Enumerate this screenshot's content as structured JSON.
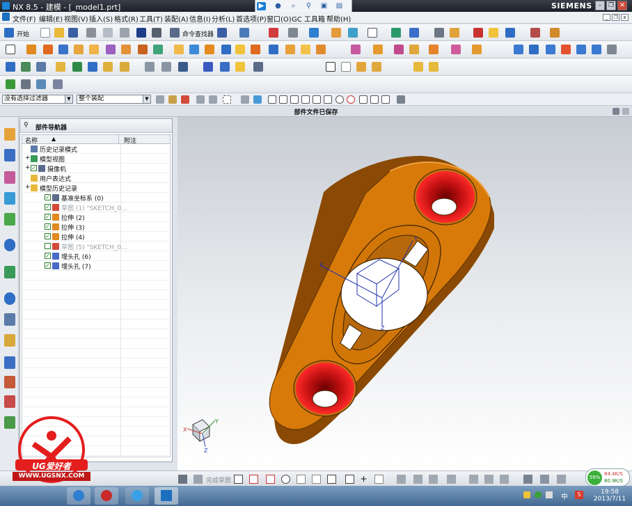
{
  "window": {
    "title": "NX 8.5 - 建模 - [_model1.prt]",
    "brand": "SIEMENS"
  },
  "menu": [
    "文件(F)",
    "编辑(E)",
    "视图(V)",
    "插入(S)",
    "格式(R)",
    "工具(T)",
    "装配(A)",
    "信息(I)",
    "分析(L)",
    "首选项(P)",
    "窗口(O)",
    "GC 工具箱",
    "帮助(H)"
  ],
  "toolbar": {
    "start_label": "开始",
    "command_finder_label": "命令查找器"
  },
  "selection": {
    "filter_value": "没有选择过滤器",
    "scope_value": "整个装配"
  },
  "status": {
    "message": "部件文件已保存"
  },
  "navigator": {
    "title": "部件导航器",
    "columns": [
      "名称",
      "附注"
    ],
    "items": [
      {
        "label": "历史记录模式",
        "level": 0,
        "icon": "clock-icon",
        "checked": null,
        "dim": false,
        "expander": false
      },
      {
        "label": "模型视图",
        "level": 0,
        "icon": "model-views-icon",
        "checked": null,
        "dim": false,
        "expander": true
      },
      {
        "label": "摄像机",
        "level": 0,
        "icon": "camera-icon",
        "checked": true,
        "dim": false,
        "expander": true
      },
      {
        "label": "用户表达式",
        "level": 0,
        "icon": "folder-icon",
        "checked": null,
        "dim": false,
        "expander": false
      },
      {
        "label": "模型历史记录",
        "level": 0,
        "icon": "folder-open-icon",
        "checked": null,
        "dim": false,
        "expander": true
      },
      {
        "label": "基准坐标系 (0)",
        "level": 1,
        "icon": "datum-csys-icon",
        "checked": true,
        "dim": false,
        "expander": false
      },
      {
        "label": "草图 (1) \"SKETCH_0...",
        "level": 1,
        "icon": "sketch-icon",
        "checked": true,
        "dim": true,
        "expander": false
      },
      {
        "label": "拉伸 (2)",
        "level": 1,
        "icon": "extrude-icon",
        "checked": true,
        "dim": false,
        "expander": false
      },
      {
        "label": "拉伸 (3)",
        "level": 1,
        "icon": "extrude-icon",
        "checked": true,
        "dim": false,
        "expander": false
      },
      {
        "label": "拉伸 (4)",
        "level": 1,
        "icon": "extrude-icon",
        "checked": true,
        "dim": false,
        "expander": false
      },
      {
        "label": "草图 (5) \"SKETCH_0...",
        "level": 1,
        "icon": "sketch-icon",
        "checked": false,
        "dim": true,
        "expander": false
      },
      {
        "label": "埋头孔 (6)",
        "level": 1,
        "icon": "countersink-hole-icon",
        "checked": true,
        "dim": false,
        "expander": false
      },
      {
        "label": "埋头孔 (7)",
        "level": 1,
        "icon": "countersink-hole-icon",
        "checked": true,
        "dim": false,
        "expander": false
      }
    ]
  },
  "viewport": {
    "triad_labels": {
      "x": "X",
      "y": "Y",
      "z": "Z"
    },
    "part_color": "#d77a0a",
    "hole_color": "#d31515"
  },
  "bottom": {
    "finish_sketch_label": "完成草图"
  },
  "watermark": {
    "brand": "UG爱好者",
    "url": "WWW.UGSNX.COM"
  },
  "tray": {
    "net_percent": "59%",
    "net_up": "84.4K/S",
    "net_down": "80.9K/S",
    "ime": "中",
    "time": "19:58",
    "date": "2013/7/11"
  }
}
